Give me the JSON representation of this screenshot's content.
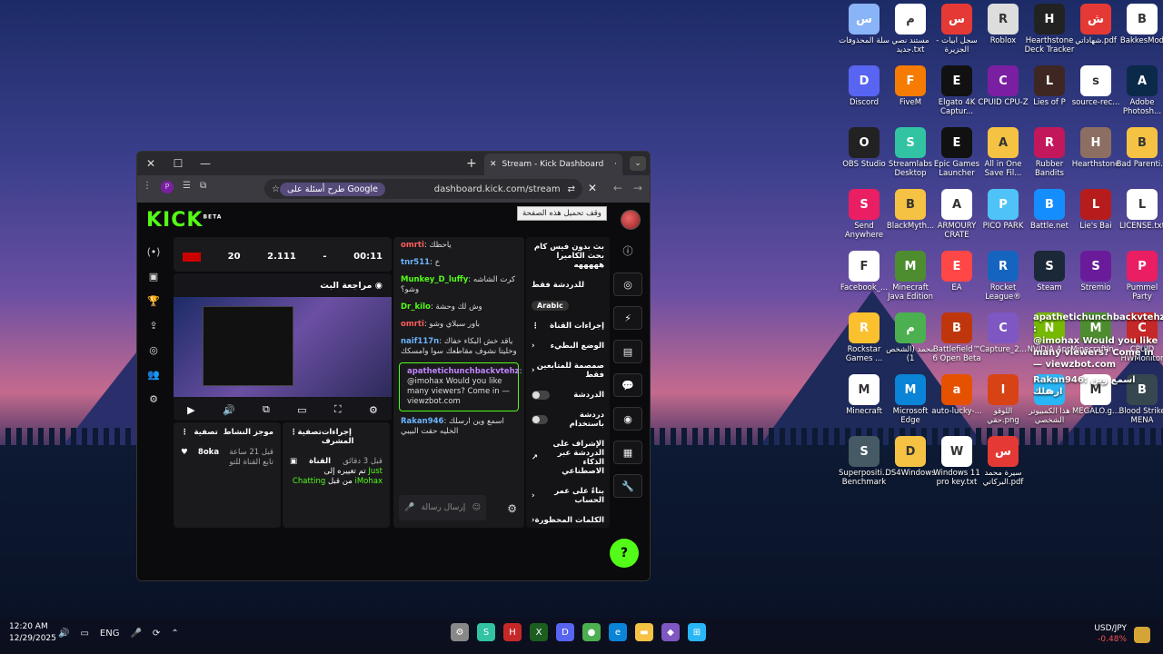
{
  "taskbar": {
    "time": "12:20 AM",
    "date": "12/29/2025",
    "language": "ENG",
    "currency_pair": "USD/JPY",
    "currency_change": "-0.48%"
  },
  "desktop_icons": [
    {
      "label": "سلة المحذوفات",
      "icon": "recycle-bin-icon",
      "color": "#8ab4f8"
    },
    {
      "label": "مستند نصي جديد.txt",
      "icon": "text-file-icon",
      "color": "#ffffff"
    },
    {
      "label": "سجل ابيات - الجزيرة",
      "icon": "pdf-icon",
      "color": "#e53935"
    },
    {
      "label": "Roblox",
      "icon": "roblox-icon",
      "color": "#dddddd"
    },
    {
      "label": "Hearthstone Deck Tracker",
      "icon": "hdt-icon",
      "color": "#222222"
    },
    {
      "label": "شهاداتي.pdf",
      "icon": "pdf-icon",
      "color": "#e53935"
    },
    {
      "label": "BakkesMod",
      "icon": "bakkesmod-icon",
      "color": "#ffffff"
    },
    {
      "label": "Discord",
      "icon": "discord-icon",
      "color": "#5865f2"
    },
    {
      "label": "FiveM",
      "icon": "fivem-icon",
      "color": "#f57c00"
    },
    {
      "label": "Elgato 4K Captur...",
      "icon": "elgato-icon",
      "color": "#111111"
    },
    {
      "label": "CPUID CPU-Z",
      "icon": "cpuz-icon",
      "color": "#7b1fa2"
    },
    {
      "label": "Lies of P",
      "icon": "liesofp-icon",
      "color": "#3e2723"
    },
    {
      "label": "source-rec...",
      "icon": "source-rec-icon",
      "color": "#ffffff"
    },
    {
      "label": "Adobe Photosh...",
      "icon": "photoshop-icon",
      "color": "#0b2a4a"
    },
    {
      "label": "OBS Studio",
      "icon": "obs-icon",
      "color": "#222222"
    },
    {
      "label": "Streamlabs Desktop",
      "icon": "streamlabs-icon",
      "color": "#31c3a2"
    },
    {
      "label": "Epic Games Launcher",
      "icon": "epic-icon",
      "color": "#111111"
    },
    {
      "label": "All in One Save Fil...",
      "icon": "folder-icon",
      "color": "#f6c244"
    },
    {
      "label": "Rubber Bandits",
      "icon": "rubber-bandits-icon",
      "color": "#c2185b"
    },
    {
      "label": "Hearthstone",
      "icon": "hearthstone-icon",
      "color": "#8d6e63"
    },
    {
      "label": "Bad Parenti...",
      "icon": "folder-icon",
      "color": "#f6c244"
    },
    {
      "label": "Send Anywhere",
      "icon": "send-anywhere-icon",
      "color": "#e91e63"
    },
    {
      "label": "BlackMyth...",
      "icon": "folder-icon",
      "color": "#f6c244"
    },
    {
      "label": "ARMOURY CRATE",
      "icon": "text-file-icon",
      "color": "#ffffff"
    },
    {
      "label": "PICO PARK",
      "icon": "picopark-icon",
      "color": "#4fc3f7"
    },
    {
      "label": "Battle.net",
      "icon": "battlenet-icon",
      "color": "#148eff"
    },
    {
      "label": "Lie's Bai",
      "icon": "lies-icon",
      "color": "#b71c1c"
    },
    {
      "label": "LICENSE.txt",
      "icon": "text-file-icon",
      "color": "#ffffff"
    },
    {
      "label": "Facebook_...",
      "icon": "text-file-icon",
      "color": "#ffffff"
    },
    {
      "label": "Minecraft Java Edition",
      "icon": "minecraft-icon",
      "color": "#4e8d2f"
    },
    {
      "label": "EA",
      "icon": "ea-icon",
      "color": "#ff4747"
    },
    {
      "label": "Rocket League®",
      "icon": "rocket-league-icon",
      "color": "#1565c0"
    },
    {
      "label": "Steam",
      "icon": "steam-icon",
      "color": "#1b2838"
    },
    {
      "label": "Stremio",
      "icon": "stremio-icon",
      "color": "#6a1b9a"
    },
    {
      "label": "Pummel Party",
      "icon": "pummel-icon",
      "color": "#e91e63"
    },
    {
      "label": "Rockstar Games ...",
      "icon": "rockstar-icon",
      "color": "#fbc02d"
    },
    {
      "label": "محمد (الشخص 1)",
      "icon": "chrome-icon",
      "color": "#4caf50"
    },
    {
      "label": "Battlefield™ 6 Open Beta",
      "icon": "battlefield-icon",
      "color": "#bf360c"
    },
    {
      "label": "Capture_2...",
      "icon": "capture-icon",
      "color": "#7e57c2"
    },
    {
      "label": "NVIDIA App",
      "icon": "nvidia-icon",
      "color": "#76b900"
    },
    {
      "label": "MinecraftIn...",
      "icon": "minecraft-icon",
      "color": "#4e8d2f"
    },
    {
      "label": "CPUID HWMonitor",
      "icon": "hwmonitor-icon",
      "color": "#c62828"
    },
    {
      "label": "Minecraft",
      "icon": "text-file-icon",
      "color": "#ffffff"
    },
    {
      "label": "Microsoft Edge",
      "icon": "edge-icon",
      "color": "#0a84d6"
    },
    {
      "label": "auto-lucky-...",
      "icon": "java-icon",
      "color": "#e65100"
    },
    {
      "label": "اللوقو حقي.png",
      "icon": "image-icon",
      "color": "#d84315"
    },
    {
      "label": "هذا الكمبيوتر الشخصي",
      "icon": "computer-icon",
      "color": "#29b6f6"
    },
    {
      "label": "MEGALO.g...",
      "icon": "text-file-icon",
      "color": "#ffffff"
    },
    {
      "label": "Blood Strike MENA",
      "icon": "bloodstrike-icon",
      "color": "#37474f"
    },
    {
      "label": "Superpositi... Benchmark",
      "icon": "superposition-icon",
      "color": "#455a64"
    },
    {
      "label": "DS4Windows",
      "icon": "folder-icon",
      "color": "#f6c244"
    },
    {
      "label": "Windows 11 pro key.txt",
      "icon": "text-file-icon",
      "color": "#ffffff"
    },
    {
      "label": "سيرة محمد البركاتي.pdf",
      "icon": "pdf-icon",
      "color": "#e53935"
    }
  ],
  "desktop_overlay": {
    "line1": "apathetichunchbackvtehz :",
    "line2": "@imohax Would you like many viewers? Come in — viewzbot.com",
    "line3": "Rakan946: اسمع وين ارسلك"
  },
  "browser": {
    "tab_title": "Stream - Kick Dashboard",
    "url": "dashboard.kick.com/stream",
    "google_pill": "طرح أسئلة على Google",
    "tooltip": "وقف تحميل هذه الصفحة"
  },
  "kick": {
    "logo": "KICK",
    "logo_sup": "BETA",
    "stats": {
      "followers": "20",
      "viewers": "2.111",
      "dash": "-",
      "time": "00:11"
    },
    "preview_title": "مراجعة البث",
    "chat": [
      {
        "user": "omrti",
        "text": "ياحظك",
        "color": "#ff5c5c"
      },
      {
        "user": "tnr511",
        "text": "خ",
        "color": "#6cb4ff"
      },
      {
        "user": "Munkey_D_luffy",
        "text": "كرت الشاشه وشو؟",
        "color": "#53fc18"
      },
      {
        "user": "Dr_kilo",
        "text": "وش لك وحشة",
        "color": "#53fc18"
      },
      {
        "user": "omrti",
        "text": "باور سبلاي وشو",
        "color": "#ff5c5c"
      },
      {
        "user": "naif117n",
        "text": "ياقد خش البكاء خفاك وخليتا نشوف مقاطعك سوا وامسكك",
        "color": "#6cb4ff"
      }
    ],
    "highlight": {
      "user": "apathetichunchbackvtehz",
      "text": "@imohax Would you like many viewers? Come in — viewzbot.com"
    },
    "last_msg": {
      "user": "Rakan946",
      "text": "اسمع وين ارسلك الخليه حقت البيبي"
    },
    "chat_placeholder": "إرسال رسالة",
    "right_panel": {
      "stream_title": "بث بدون فيس كام بحث الكاميرا هههههه",
      "chat_only": "للدردشة فقط",
      "language": "Arabic",
      "channel_actions": "إجراءات القناة",
      "slow_mode": "الوضع البطيء",
      "followers_only": "صمصمة للمتابعين فقط",
      "chat_toggle": "الدردشة",
      "account_chat": "دردشة باستخدام",
      "ai_moderation": "الإشراف على الدردشة عبر الذكاء الاصطناعي",
      "account_age": "بناءً على عمر الحساب",
      "banned_words": "الكلمات المحظورة"
    },
    "activity": {
      "title": "موجز النشاط",
      "filter": "تصفية",
      "user": "8oka",
      "time": "قبل 21 ساعة",
      "desc": "تابع القناة للتو"
    },
    "channel_box": {
      "title": "إجراءات المشرف",
      "filter": "تصفية",
      "label": "القناة",
      "time": "قبل 3 دقائق",
      "desc_a": "تم تغييره إلى",
      "desc_highlight": "Just Chatting",
      "desc_b": "من قبل",
      "desc_user": "iMohax"
    }
  }
}
